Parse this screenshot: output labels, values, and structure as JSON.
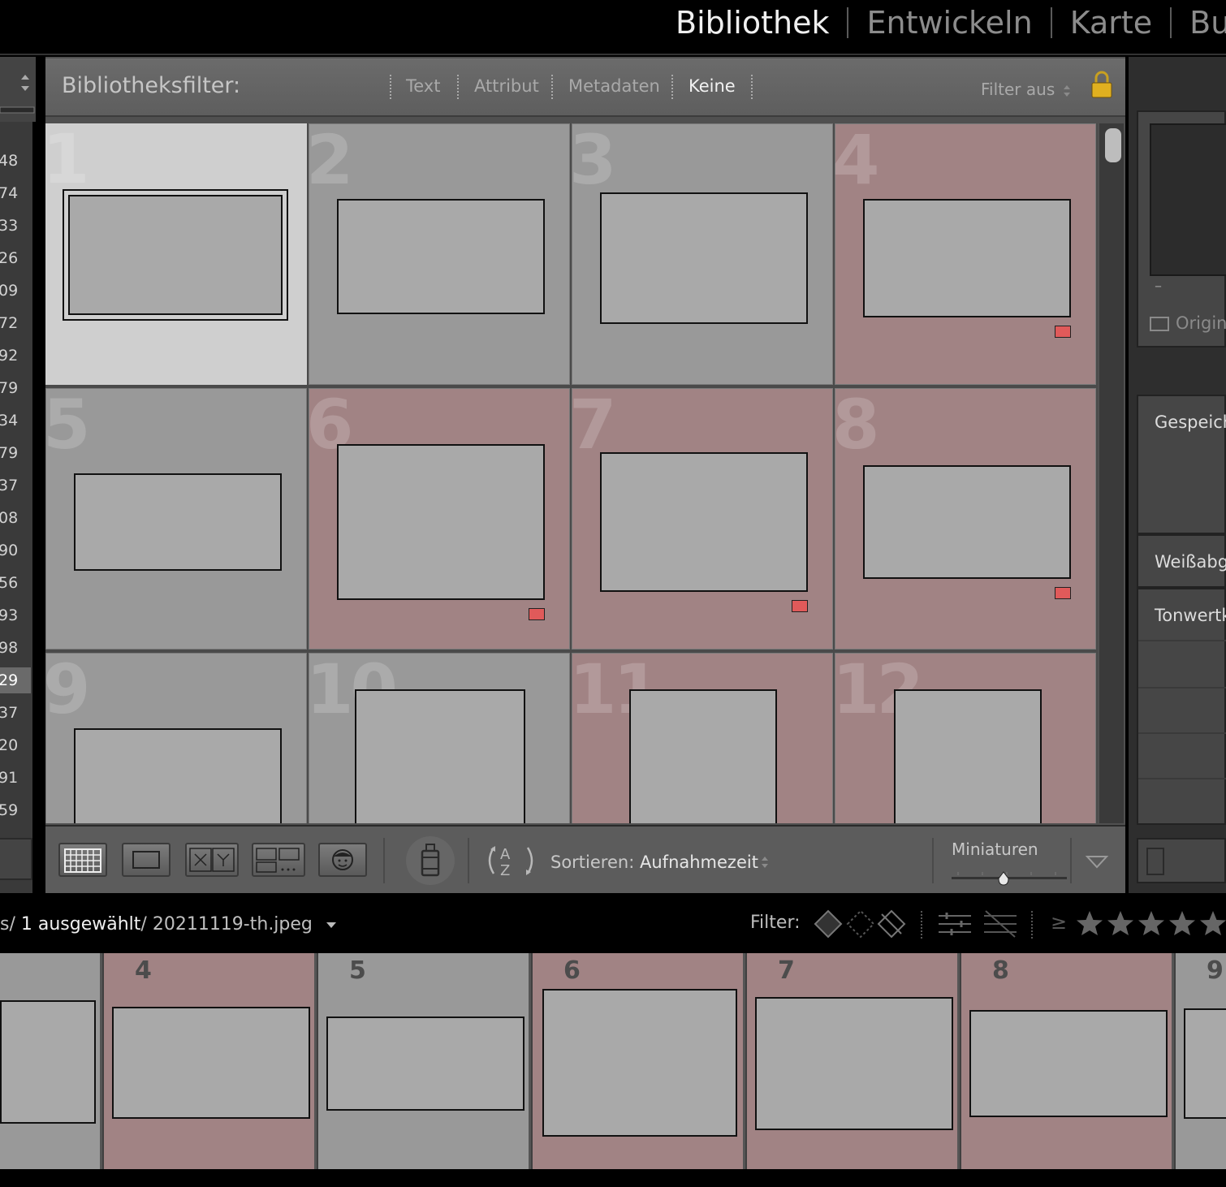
{
  "modules": {
    "items": [
      {
        "label": "Bibliothek",
        "active": true
      },
      {
        "label": "Entwickeln",
        "active": false
      },
      {
        "label": "Karte",
        "active": false
      },
      {
        "label": "Buc",
        "active": false
      }
    ]
  },
  "left_panel": {
    "numbers": [
      "48",
      "74",
      "33",
      "26",
      "09",
      "72",
      "92",
      "79",
      "34",
      "79",
      "37",
      "08",
      "90",
      "56",
      "93",
      "98",
      "29",
      "37",
      "20",
      "91",
      "59"
    ],
    "selected_index": 16
  },
  "filter_bar": {
    "title": "Bibliotheksfilter:",
    "tabs": [
      {
        "label": "Text",
        "active": false
      },
      {
        "label": "Attribut",
        "active": false
      },
      {
        "label": "Metadaten",
        "active": false
      },
      {
        "label": "Keine",
        "active": true
      }
    ],
    "preset": "Filter aus"
  },
  "grid": {
    "cells": [
      {
        "number": "1",
        "selected": true,
        "flagged": false
      },
      {
        "number": "2",
        "selected": false,
        "flagged": false
      },
      {
        "number": "3",
        "selected": false,
        "flagged": false
      },
      {
        "number": "4",
        "selected": false,
        "flagged": true
      },
      {
        "number": "5",
        "selected": false,
        "flagged": false
      },
      {
        "number": "6",
        "selected": false,
        "flagged": true
      },
      {
        "number": "7",
        "selected": false,
        "flagged": true
      },
      {
        "number": "8",
        "selected": false,
        "flagged": true
      },
      {
        "number": "9",
        "selected": false,
        "flagged": false
      },
      {
        "number": "10",
        "selected": false,
        "flagged": false
      },
      {
        "number": "11",
        "selected": false,
        "flagged": true
      },
      {
        "number": "12",
        "selected": false,
        "flagged": true
      }
    ]
  },
  "toolbar": {
    "sort_label": "Sortieren:",
    "sort_value": "Aufnahmezeit",
    "thumbnails_label": "Miniaturen"
  },
  "right_panel": {
    "preview_value": "–",
    "original_label": "Origina",
    "saved_label": "Gespeich",
    "wb_label": "Weißabg",
    "tone_label": "Tonwertk"
  },
  "info_bar": {
    "path_prefix": "s/ ",
    "selected_text": "1 ausgewählt",
    "path_sep": "/ ",
    "filename": "20211119-th.jpeg",
    "filter_label": "Filter:",
    "rating_op": "≥"
  },
  "filmstrip": {
    "cells": [
      {
        "number": "",
        "flagged": false
      },
      {
        "number": "4",
        "flagged": true
      },
      {
        "number": "5",
        "flagged": false
      },
      {
        "number": "6",
        "flagged": true
      },
      {
        "number": "7",
        "flagged": true
      },
      {
        "number": "8",
        "flagged": true
      },
      {
        "number": "9",
        "flagged": false
      }
    ]
  },
  "colors": {
    "flagged_bg": "#a18384",
    "normal_bg": "#999999",
    "selected_bg": "#cfcfcf",
    "reject_red": "#e05a5a"
  }
}
